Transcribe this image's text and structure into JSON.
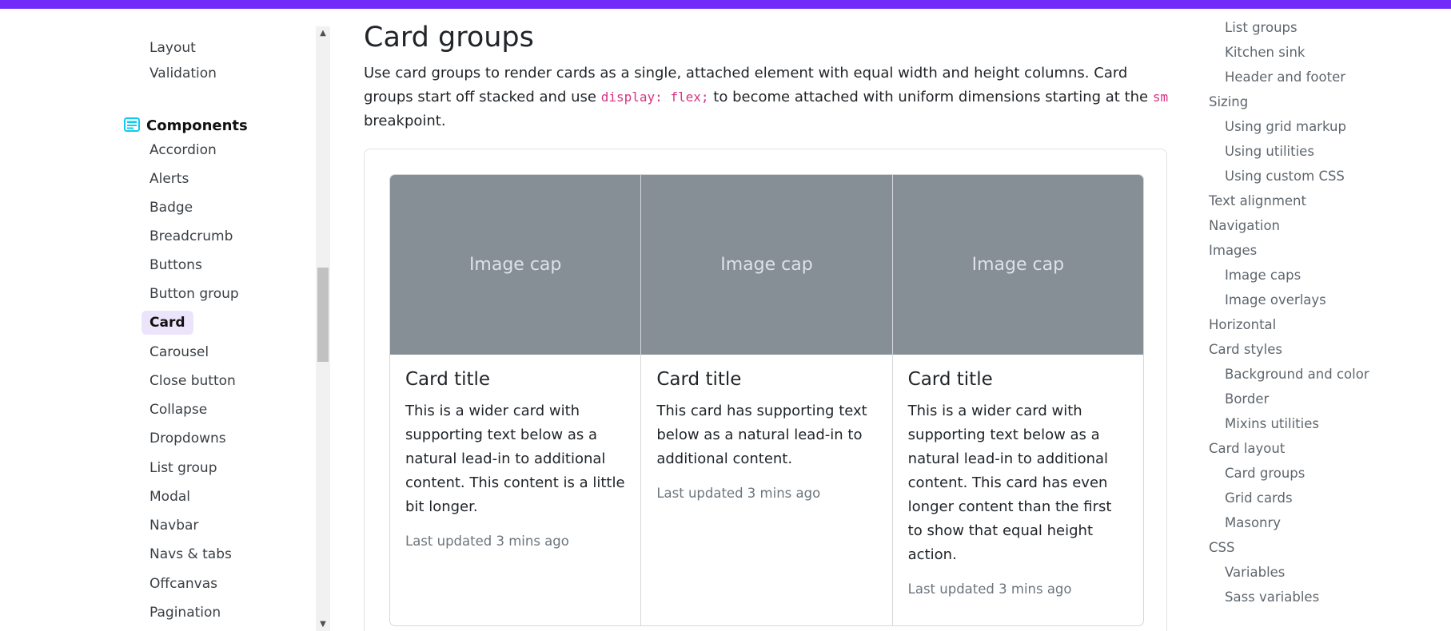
{
  "sidebar": {
    "top_items": [
      "Layout",
      "Validation"
    ],
    "section_title": "Components",
    "items": [
      "Accordion",
      "Alerts",
      "Badge",
      "Breadcrumb",
      "Buttons",
      "Button group",
      "Card",
      "Carousel",
      "Close button",
      "Collapse",
      "Dropdowns",
      "List group",
      "Modal",
      "Navbar",
      "Navs & tabs",
      "Offcanvas",
      "Pagination"
    ],
    "active_item": "Card"
  },
  "main": {
    "title": "Card groups",
    "intro": {
      "part1": "Use card groups to render cards as a single, attached element with equal width and height columns. Card groups start off stacked and use ",
      "code1": "display: flex;",
      "part2": " to become attached with uniform dimensions starting at the ",
      "code2": "sm",
      "part3": " breakpoint."
    },
    "cards": [
      {
        "image_cap": "Image cap",
        "title": "Card title",
        "text": "This is a wider card with supporting text below as a natural lead-in to additional content. This content is a little bit longer.",
        "meta": "Last updated 3 mins ago"
      },
      {
        "image_cap": "Image cap",
        "title": "Card title",
        "text": "This card has supporting text below as a natural lead-in to additional content.",
        "meta": "Last updated 3 mins ago"
      },
      {
        "image_cap": "Image cap",
        "title": "Card title",
        "text": "This is a wider card with supporting text below as a natural lead-in to additional content. This card has even longer content than the first to show that equal height action.",
        "meta": "Last updated 3 mins ago"
      }
    ]
  },
  "toc": {
    "items": [
      {
        "label": "List groups",
        "level": 2
      },
      {
        "label": "Kitchen sink",
        "level": 2
      },
      {
        "label": "Header and footer",
        "level": 2
      },
      {
        "label": "Sizing",
        "level": 1
      },
      {
        "label": "Using grid markup",
        "level": 2
      },
      {
        "label": "Using utilities",
        "level": 2
      },
      {
        "label": "Using custom CSS",
        "level": 2
      },
      {
        "label": "Text alignment",
        "level": 1
      },
      {
        "label": "Navigation",
        "level": 1
      },
      {
        "label": "Images",
        "level": 1
      },
      {
        "label": "Image caps",
        "level": 2
      },
      {
        "label": "Image overlays",
        "level": 2
      },
      {
        "label": "Horizontal",
        "level": 1
      },
      {
        "label": "Card styles",
        "level": 1
      },
      {
        "label": "Background and color",
        "level": 2
      },
      {
        "label": "Border",
        "level": 2
      },
      {
        "label": "Mixins utilities",
        "level": 2
      },
      {
        "label": "Card layout",
        "level": 1
      },
      {
        "label": "Card groups",
        "level": 2
      },
      {
        "label": "Grid cards",
        "level": 2
      },
      {
        "label": "Masonry",
        "level": 2
      },
      {
        "label": "CSS",
        "level": 1
      },
      {
        "label": "Variables",
        "level": 2
      },
      {
        "label": "Sass variables",
        "level": 2
      }
    ]
  },
  "colors": {
    "brand": "#712cf9",
    "active_bg": "#ece4fb",
    "image_cap_bg": "#868e96",
    "code": "#d63384"
  },
  "icons": {
    "section_icon": "components-icon",
    "scroll_up": "scroll-up-arrow-icon",
    "scroll_down": "scroll-down-arrow-icon"
  }
}
